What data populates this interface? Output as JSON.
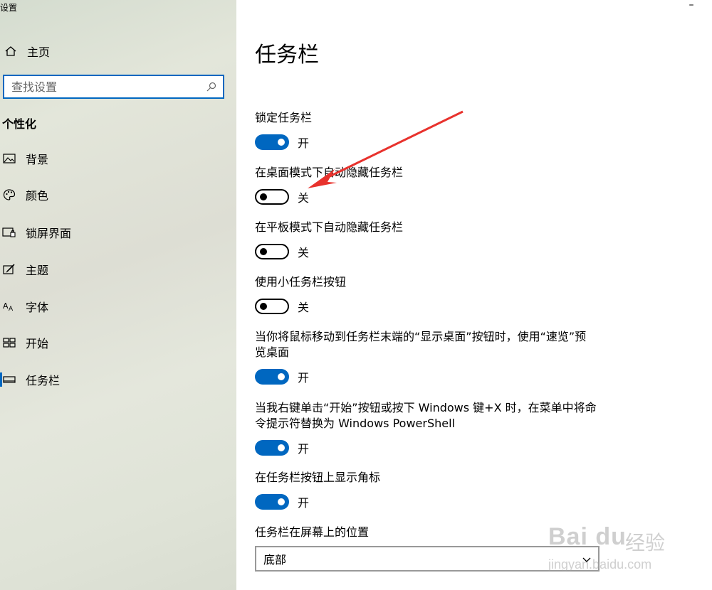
{
  "window": {
    "title": "设置",
    "minimize_label": "–"
  },
  "sidebar": {
    "home_label": "主页",
    "search_placeholder": "查找设置",
    "section_heading": "个性化",
    "items": [
      {
        "label": "背景",
        "icon": "background-picture-icon"
      },
      {
        "label": "颜色",
        "icon": "palette-icon"
      },
      {
        "label": "锁屏界面",
        "icon": "lock-screen-icon"
      },
      {
        "label": "主题",
        "icon": "theme-brush-icon"
      },
      {
        "label": "字体",
        "icon": "font-icon"
      },
      {
        "label": "开始",
        "icon": "start-grid-icon"
      },
      {
        "label": "任务栏",
        "icon": "taskbar-icon"
      }
    ]
  },
  "main": {
    "title": "任务栏",
    "settings": [
      {
        "label": "锁定任务栏",
        "state": "开",
        "on": true
      },
      {
        "label": "在桌面模式下自动隐藏任务栏",
        "state": "关",
        "on": false
      },
      {
        "label": "在平板模式下自动隐藏任务栏",
        "state": "关",
        "on": false
      },
      {
        "label": "使用小任务栏按钮",
        "state": "关",
        "on": false
      },
      {
        "label_line1": "当你将鼠标移动到任务栏末端的“显示桌面”按钮时，使用“速览”预",
        "label_line2": "览桌面",
        "state": "开",
        "on": true
      },
      {
        "label_line1": "当我右键单击“开始”按钮或按下 Windows 键+X 时，在菜单中将命",
        "label_line2": "令提示符替换为 Windows PowerShell",
        "state": "开",
        "on": true
      },
      {
        "label": "在任务栏按钮上显示角标",
        "state": "开",
        "on": true
      }
    ],
    "position_label": "任务栏在屏幕上的位置",
    "position_value": "底部"
  },
  "colors": {
    "accent": "#0067c0",
    "annotation": "#e8322d"
  },
  "watermark": {
    "brand": "Bai du",
    "cn": "经验",
    "url": "jingyan.baidu.com"
  }
}
